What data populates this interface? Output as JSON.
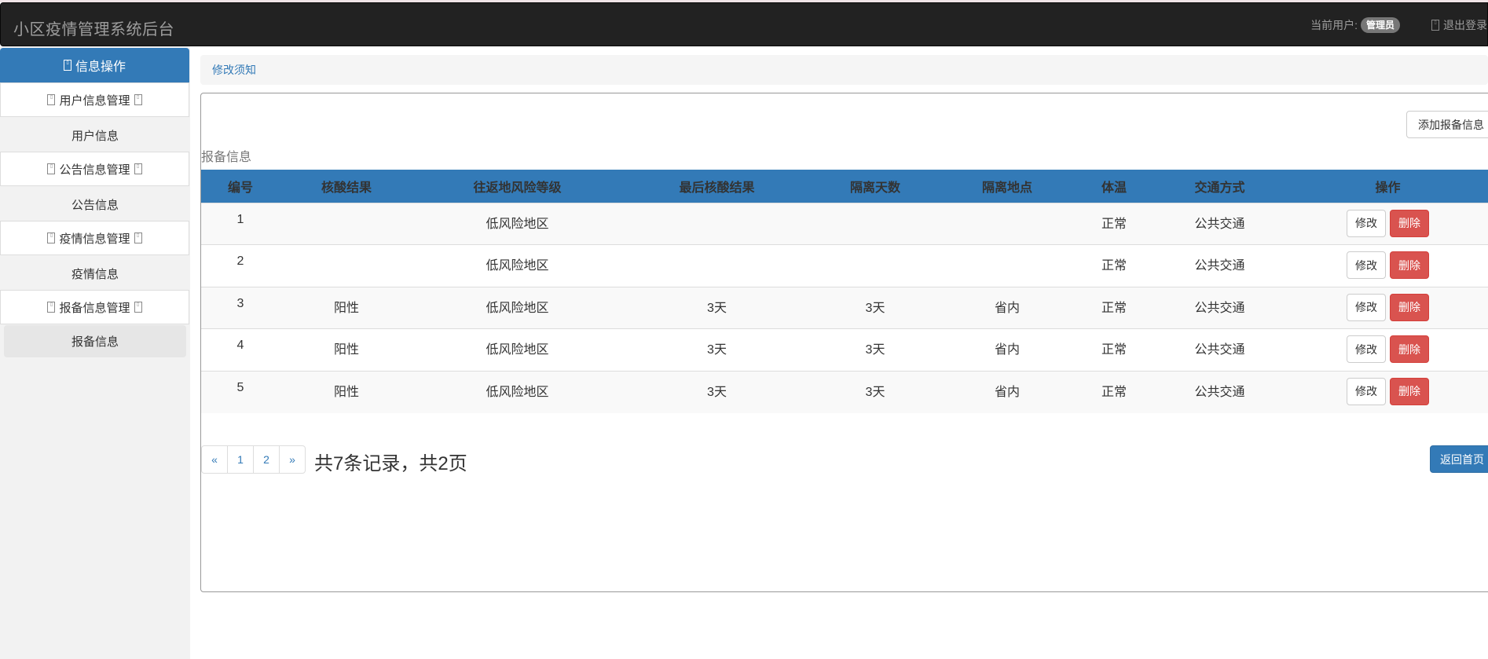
{
  "header": {
    "brand": "小区疫情管理系统后台",
    "current_user_label": "当前用户:",
    "current_user": "管理员",
    "logout": "退出登录"
  },
  "sidebar": {
    "title": "信息操作",
    "groups": [
      {
        "label": "用户信息管理",
        "sub": "用户信息"
      },
      {
        "label": "公告信息管理",
        "sub": "公告信息"
      },
      {
        "label": "疫情信息管理",
        "sub": "疫情信息"
      },
      {
        "label": "报备信息管理",
        "sub": "报备信息"
      }
    ]
  },
  "breadcrumb": {
    "link": "修改须知"
  },
  "panel": {
    "add_button": "添加报备信息",
    "section_title": "报备信息"
  },
  "table": {
    "headers": [
      "编号",
      "核酸结果",
      "往返地风险等级",
      "最后核酸结果",
      "隔离天数",
      "隔离地点",
      "体温",
      "交通方式",
      "操作"
    ],
    "rows": [
      [
        "1",
        "",
        "低风险地区",
        "",
        "",
        "",
        "正常",
        "公共交通"
      ],
      [
        "2",
        "",
        "低风险地区",
        "",
        "",
        "",
        "正常",
        "公共交通"
      ],
      [
        "3",
        "阳性",
        "低风险地区",
        "3天",
        "3天",
        "省内",
        "正常",
        "公共交通"
      ],
      [
        "4",
        "阳性",
        "低风险地区",
        "3天",
        "3天",
        "省内",
        "正常",
        "公共交通"
      ],
      [
        "5",
        "阳性",
        "低风险地区",
        "3天",
        "3天",
        "省内",
        "正常",
        "公共交通"
      ]
    ],
    "edit_label": "修改",
    "delete_label": "删除"
  },
  "pagination": {
    "prev": "«",
    "pages": [
      "1",
      "2"
    ],
    "next": "»",
    "summary": "共7条记录，共2页",
    "home_button": "返回首页"
  },
  "colors": {
    "navbar_bg": "#222222",
    "primary": "#337ab7",
    "danger": "#d9534f",
    "sidebar_bg": "#f2f2f2"
  }
}
